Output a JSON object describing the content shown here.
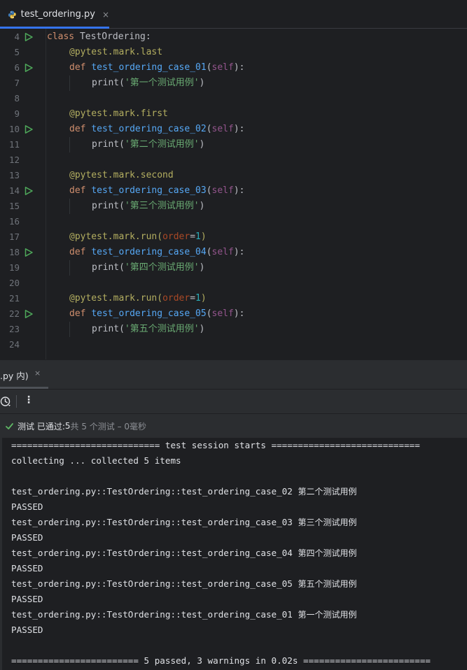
{
  "editor_tab": {
    "filename": "test_ordering.py",
    "close": "×"
  },
  "editor_lines": [
    {
      "n": "4",
      "run": true,
      "indent": 0,
      "tokens": [
        {
          "c": "kw",
          "t": "class"
        },
        {
          "c": "plain",
          "t": " TestOrdering:"
        }
      ]
    },
    {
      "n": "5",
      "run": false,
      "indent": 1,
      "tokens": [
        {
          "c": "deco",
          "t": "@pytest.mark.last"
        }
      ]
    },
    {
      "n": "6",
      "run": true,
      "indent": 1,
      "tokens": [
        {
          "c": "kw",
          "t": "def"
        },
        {
          "c": "plain",
          "t": " "
        },
        {
          "c": "fn",
          "t": "test_ordering_case_01"
        },
        {
          "c": "plain",
          "t": "("
        },
        {
          "c": "self",
          "t": "self"
        },
        {
          "c": "plain",
          "t": "):"
        }
      ]
    },
    {
      "n": "7",
      "run": false,
      "indent": 2,
      "tokens": [
        {
          "c": "plain",
          "t": "print("
        },
        {
          "c": "str",
          "t": "'第一个测试用例'"
        },
        {
          "c": "plain",
          "t": ")"
        }
      ]
    },
    {
      "n": "8",
      "run": false,
      "indent": 0,
      "tokens": []
    },
    {
      "n": "9",
      "run": false,
      "indent": 1,
      "tokens": [
        {
          "c": "deco",
          "t": "@pytest.mark.first"
        }
      ]
    },
    {
      "n": "10",
      "run": true,
      "indent": 1,
      "tokens": [
        {
          "c": "kw",
          "t": "def"
        },
        {
          "c": "plain",
          "t": " "
        },
        {
          "c": "fn",
          "t": "test_ordering_case_02"
        },
        {
          "c": "plain",
          "t": "("
        },
        {
          "c": "self",
          "t": "self"
        },
        {
          "c": "plain",
          "t": "):"
        }
      ]
    },
    {
      "n": "11",
      "run": false,
      "indent": 2,
      "tokens": [
        {
          "c": "plain",
          "t": "print("
        },
        {
          "c": "str",
          "t": "'第二个测试用例'"
        },
        {
          "c": "plain",
          "t": ")"
        }
      ]
    },
    {
      "n": "12",
      "run": false,
      "indent": 0,
      "tokens": []
    },
    {
      "n": "13",
      "run": false,
      "indent": 1,
      "tokens": [
        {
          "c": "deco",
          "t": "@pytest.mark.second"
        }
      ]
    },
    {
      "n": "14",
      "run": true,
      "indent": 1,
      "tokens": [
        {
          "c": "kw",
          "t": "def"
        },
        {
          "c": "plain",
          "t": " "
        },
        {
          "c": "fn",
          "t": "test_ordering_case_03"
        },
        {
          "c": "plain",
          "t": "("
        },
        {
          "c": "self",
          "t": "self"
        },
        {
          "c": "plain",
          "t": "):"
        }
      ]
    },
    {
      "n": "15",
      "run": false,
      "indent": 2,
      "tokens": [
        {
          "c": "plain",
          "t": "print("
        },
        {
          "c": "str",
          "t": "'第三个测试用例'"
        },
        {
          "c": "plain",
          "t": ")"
        }
      ]
    },
    {
      "n": "16",
      "run": false,
      "indent": 0,
      "tokens": []
    },
    {
      "n": "17",
      "run": false,
      "indent": 1,
      "tokens": [
        {
          "c": "deco",
          "t": "@pytest.mark.run("
        },
        {
          "c": "param",
          "t": "order"
        },
        {
          "c": "plain",
          "t": "="
        },
        {
          "c": "num",
          "t": "1"
        },
        {
          "c": "deco",
          "t": ")"
        }
      ]
    },
    {
      "n": "18",
      "run": true,
      "indent": 1,
      "tokens": [
        {
          "c": "kw",
          "t": "def"
        },
        {
          "c": "plain",
          "t": " "
        },
        {
          "c": "fn",
          "t": "test_ordering_case_04"
        },
        {
          "c": "plain",
          "t": "("
        },
        {
          "c": "self",
          "t": "self"
        },
        {
          "c": "plain",
          "t": "):"
        }
      ]
    },
    {
      "n": "19",
      "run": false,
      "indent": 2,
      "tokens": [
        {
          "c": "plain",
          "t": "print("
        },
        {
          "c": "str",
          "t": "'第四个测试用例'"
        },
        {
          "c": "plain",
          "t": ")"
        }
      ]
    },
    {
      "n": "20",
      "run": false,
      "indent": 0,
      "tokens": []
    },
    {
      "n": "21",
      "run": false,
      "indent": 1,
      "tokens": [
        {
          "c": "deco",
          "t": "@pytest.mark.run("
        },
        {
          "c": "param",
          "t": "order"
        },
        {
          "c": "plain",
          "t": "="
        },
        {
          "c": "num",
          "t": "1"
        },
        {
          "c": "deco",
          "t": ")"
        }
      ]
    },
    {
      "n": "22",
      "run": true,
      "indent": 1,
      "tokens": [
        {
          "c": "kw",
          "t": "def"
        },
        {
          "c": "plain",
          "t": " "
        },
        {
          "c": "fn",
          "t": "test_ordering_case_05"
        },
        {
          "c": "plain",
          "t": "("
        },
        {
          "c": "self",
          "t": "self"
        },
        {
          "c": "plain",
          "t": "):"
        }
      ]
    },
    {
      "n": "23",
      "run": false,
      "indent": 2,
      "tokens": [
        {
          "c": "plain",
          "t": "print("
        },
        {
          "c": "str",
          "t": "'第五个测试用例'"
        },
        {
          "c": "plain",
          "t": ")"
        }
      ]
    },
    {
      "n": "24",
      "run": false,
      "indent": 0,
      "tokens": []
    }
  ],
  "run_panel": {
    "tab_label": ".py 内)",
    "tab_close": "×",
    "more_menu": "⋮",
    "status": {
      "label": "测试 已通过: ",
      "count": "5",
      "detail": "共 5 个测试 – 0毫秒"
    }
  },
  "console_lines": [
    "============================ test session starts ============================",
    "collecting ... collected 5 items",
    "",
    "test_ordering.py::TestOrdering::test_ordering_case_02 第二个测试用例",
    "PASSED",
    "test_ordering.py::TestOrdering::test_ordering_case_03 第三个测试用例",
    "PASSED",
    "test_ordering.py::TestOrdering::test_ordering_case_04 第四个测试用例",
    "PASSED",
    "test_ordering.py::TestOrdering::test_ordering_case_05 第五个测试用例",
    "PASSED",
    "test_ordering.py::TestOrdering::test_ordering_case_01 第一个测试用例",
    "PASSED",
    "",
    "======================== 5 passed, 3 warnings in 0.02s ========================"
  ],
  "colors": {
    "keyword": "#cf8e6d",
    "decorator": "#b3ae60",
    "function": "#56a8f5",
    "self": "#94558d",
    "string": "#6aab73",
    "number": "#2aacb8",
    "run_icon": "#4ea85a",
    "pass_check": "#5fb865",
    "accent": "#3574f0"
  }
}
